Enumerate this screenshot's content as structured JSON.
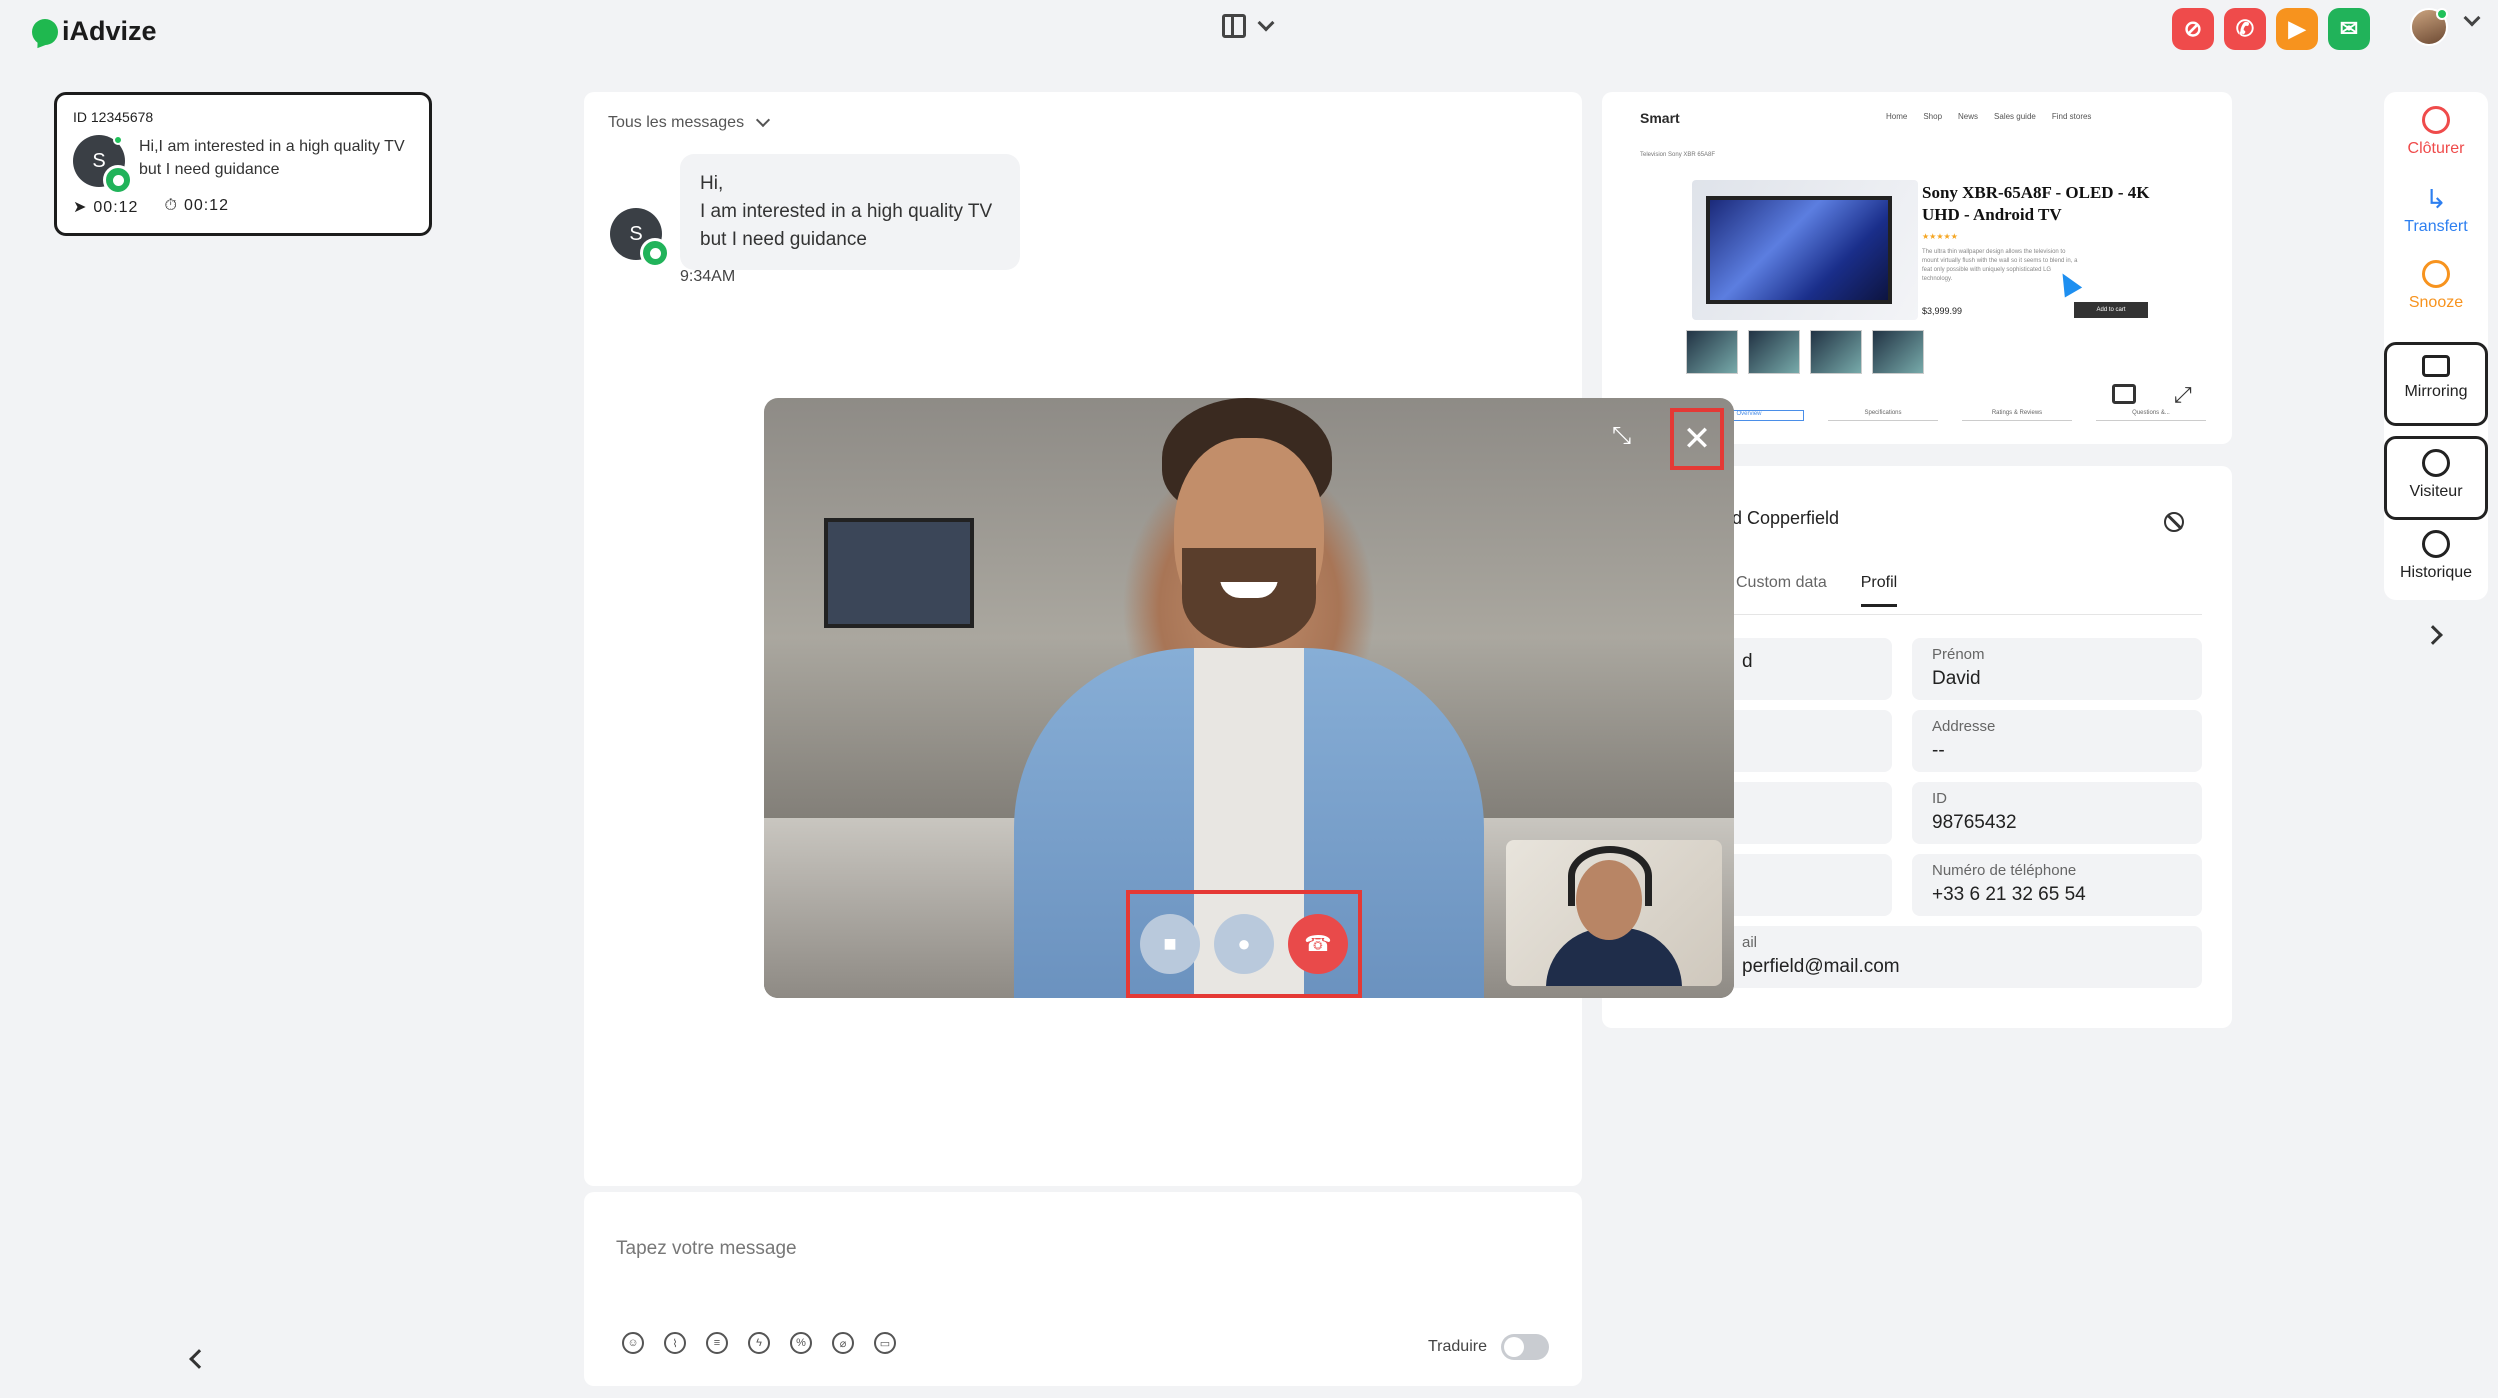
{
  "app": {
    "logo_text": "iAdvize",
    "brand_color": "#1fb84f"
  },
  "topbar": {
    "layout_icon": "layout-columns-icon",
    "status_buttons": [
      {
        "name": "no-chat-icon",
        "color": "#ef4b4b",
        "glyph": "⊘"
      },
      {
        "name": "no-call-icon",
        "color": "#ef4b4b",
        "glyph": "✆"
      },
      {
        "name": "video-icon",
        "color": "#f7931e",
        "glyph": "▶"
      },
      {
        "name": "chat-icon",
        "color": "#21b35a",
        "glyph": "✉"
      }
    ]
  },
  "conversation": {
    "id": "ID 12345678",
    "avatar_initial": "S",
    "preview": "Hi,I am interested in a high quality TV but I need guidance",
    "time_sent": "00:12",
    "time_wait": "00:12"
  },
  "chat": {
    "filter_label": "Tous les messages",
    "message": {
      "avatar_initial": "S",
      "lines": [
        "Hi,",
        "I am interested in a high quality TV",
        "but I need guidance"
      ],
      "time": "9:34AM"
    },
    "composer_placeholder": "Tapez votre message",
    "translate_label": "Traduire",
    "tools": [
      "☺",
      "⌇",
      "≡",
      "ϟ",
      "%",
      "⌀",
      "▭"
    ]
  },
  "preview": {
    "brand": "Smart",
    "nav": [
      "Home",
      "Shop",
      "News",
      "Sales guide",
      "Find stores"
    ],
    "crumb": "Television  Sony XBR 65A8F",
    "product_title": "Sony XBR-65A8F - OLED - 4K UHD - Android TV",
    "stars": "★★★★★",
    "desc": "The ultra thin wallpaper design allows the television to mount virtually flush with the wall so it seems to blend in, a feat only possible with uniquely sophisticated LG technology.",
    "price": "$3,999.99",
    "cart": "Add to cart",
    "tabs": [
      "Overview",
      "Specifications",
      "Ratings & Reviews",
      "Questions &..."
    ]
  },
  "visitor": {
    "name_partial": "d Copperfield",
    "tabs": [
      "Custom data",
      "Profil"
    ],
    "fields": [
      {
        "label": "",
        "value": "d"
      },
      {
        "label": "Prénom",
        "value": "David"
      },
      {
        "label": "Addresse",
        "value": "--"
      },
      {
        "label": "ID",
        "value": "98765432"
      },
      {
        "label": "Numéro de téléphone",
        "value": "+33 6 21 32 65 54"
      },
      {
        "label": "ail",
        "value": "perfield@mail.com"
      }
    ]
  },
  "rail": {
    "cloturer": "Clôturer",
    "transfert": "Transfert",
    "snooze": "Snooze",
    "mirroring": "Mirroring",
    "visiteur": "Visiteur",
    "historique": "Historique",
    "colors": {
      "close": "#ef4b4b",
      "transfer": "#2d7ff0",
      "snooze": "#f7931e"
    }
  },
  "video_call": {
    "close_glyph": "✕",
    "minimize_glyph": "⤡",
    "controls": [
      {
        "name": "camera-icon",
        "glyph": "■",
        "color": "#b9c9dc"
      },
      {
        "name": "microphone-icon",
        "glyph": "●",
        "color": "#b9c9dc"
      },
      {
        "name": "hang-up-icon",
        "glyph": "☎",
        "color": "#e94a4a"
      }
    ]
  }
}
